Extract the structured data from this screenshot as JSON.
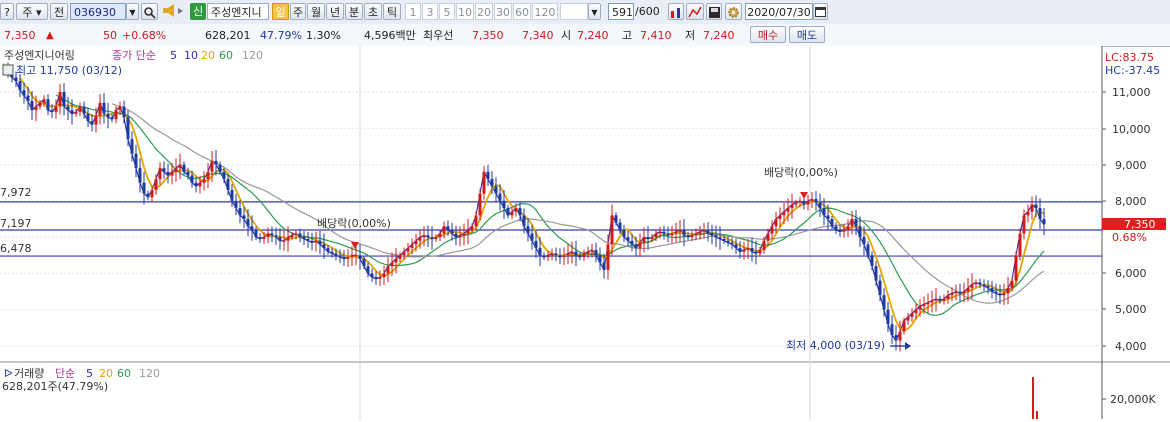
{
  "toolbar": {
    "menu_label": "주",
    "mode_label": "전",
    "code_value": "036930",
    "credit_label": "신",
    "stock_name": "주성엔지니",
    "period_selected": "일",
    "period_tabs": [
      "주",
      "월",
      "년",
      "분",
      "초",
      "틱"
    ],
    "interval_buttons": [
      "1",
      "3",
      "5",
      "10",
      "20",
      "30",
      "60",
      "120"
    ],
    "count_value": "591",
    "count_total": "/600",
    "date_value": "2020/07/30"
  },
  "quote": {
    "price": "7,350",
    "change_arrow": "▲",
    "change_value": "50",
    "change_pct": "+0.68%",
    "volume": "628,201",
    "turnover_pct": "47.79%",
    "ratio": "1.30%",
    "amount": "4,596백만",
    "best_bid_label": "최우선",
    "best_ask": "7,350",
    "best_bid": "7,340",
    "open_label": "시",
    "open": "7,240",
    "high_label": "고",
    "high": "7,410",
    "low_label": "저",
    "low": "7,240",
    "buy_label": "매수",
    "sell_label": "매도"
  },
  "colors": {
    "up": "#d21a1a",
    "down": "#1f3b9c",
    "ma5": "#2e2ea8",
    "ma20": "#e6a500",
    "ma60": "#2e9a52",
    "ma120": "#999999",
    "hline": "#3a3ab0",
    "price_tag": "#e01e1e"
  },
  "chart": {
    "legend": {
      "name": "주성엔지니어링",
      "price_label": "종가 단순",
      "ma": [
        "5",
        "10",
        "20",
        "60",
        "120"
      ]
    },
    "max_label": "최고 11,750 (03/12)",
    "min_label": "최저 4,000 (03/19)",
    "dividend_labels": [
      "배당락(0,00%)",
      "배당락(0,00%)"
    ],
    "hlines": [
      "7,972",
      "7,197",
      "6,478"
    ],
    "lc_label": "LC:83.75",
    "hc_label": "HC:-37.45",
    "price_tag": "7,350",
    "price_tag_pct": "0.68%",
    "y_ticks": [
      "11,000",
      "10,000",
      "9,000",
      "8,000",
      "6,000",
      "5,000",
      "4,000"
    ],
    "volume_legend": {
      "name": "거래량",
      "label": "단순",
      "ma": [
        "5",
        "20",
        "60",
        "120"
      ],
      "info": "628,201주(47.79%)"
    },
    "volume_tick": "20,000K"
  },
  "chart_data": {
    "type": "line",
    "x": [
      0,
      4,
      8,
      12,
      16,
      20,
      24,
      28,
      32,
      36,
      40,
      44,
      48,
      52,
      56,
      60,
      64,
      68,
      72,
      76,
      80,
      84,
      88,
      92,
      96,
      100,
      104,
      108,
      112,
      116,
      120,
      124,
      128,
      132,
      136,
      140,
      144,
      148,
      152,
      156,
      160,
      164,
      168,
      172,
      176,
      180,
      184,
      188,
      192,
      196,
      200,
      204,
      208,
      212,
      216,
      220,
      224,
      228,
      232,
      236,
      240,
      244,
      248,
      252,
      256,
      260,
      264,
      268,
      272,
      276,
      280,
      284,
      288,
      292,
      296,
      300,
      304,
      308,
      312,
      316,
      320,
      324,
      328,
      332,
      336,
      340,
      344,
      348,
      352,
      356,
      360,
      364,
      368,
      372,
      376,
      380,
      384,
      388,
      392,
      396,
      400,
      404,
      408,
      412,
      416,
      420,
      424,
      428,
      432,
      436,
      440,
      444,
      448,
      452,
      456,
      460,
      464,
      468,
      472,
      476,
      480,
      484,
      488,
      492,
      496,
      500,
      504,
      508,
      512,
      516,
      520,
      524,
      528,
      532,
      536,
      540,
      544,
      548,
      552,
      556,
      560,
      564,
      568,
      572,
      576,
      580,
      584,
      588,
      592,
      596,
      600,
      604,
      608,
      612,
      616,
      620,
      624,
      628,
      632,
      636,
      640,
      644,
      648,
      652,
      656,
      660,
      664,
      668,
      672,
      676,
      680,
      684,
      688,
      692,
      696,
      700,
      704,
      708,
      712,
      716,
      720,
      724,
      728,
      732,
      736,
      740,
      744,
      748,
      752,
      756,
      760,
      764,
      768,
      772,
      776,
      780,
      784,
      788,
      792,
      796,
      800,
      804,
      808,
      812,
      816,
      820,
      824,
      828,
      832,
      836,
      840,
      844,
      848,
      852,
      856,
      860,
      864,
      868,
      872,
      876,
      880,
      884,
      888,
      892,
      896,
      900,
      904,
      908,
      912,
      916,
      920,
      924,
      928,
      932,
      936,
      940,
      944,
      948,
      952,
      956,
      960,
      964,
      968,
      972,
      976,
      980,
      984,
      988,
      992,
      996,
      1000,
      1004,
      1008,
      1012,
      1016,
      1020,
      1024,
      1028,
      1032,
      1036,
      1040,
      1044,
      1048,
      1052,
      1056,
      1060,
      1064,
      1068
    ],
    "values": [
      11700,
      11500,
      11400,
      11300,
      11050,
      10900,
      10750,
      10500,
      10600,
      10700,
      10800,
      10500,
      10450,
      10600,
      11000,
      10600,
      10500,
      10400,
      10450,
      10600,
      10400,
      10200,
      10100,
      10350,
      10700,
      10400,
      10300,
      10250,
      10500,
      10600,
      10300,
      9700,
      9300,
      8900,
      8500,
      8200,
      8100,
      8300,
      8600,
      8900,
      8800,
      8700,
      8800,
      8900,
      9000,
      8800,
      8700,
      8500,
      8400,
      8500,
      8600,
      8800,
      9100,
      9000,
      8800,
      8600,
      8300,
      8000,
      7800,
      7600,
      7500,
      7300,
      7200,
      7000,
      6950,
      7000,
      7100,
      7050,
      7000,
      6900,
      6900,
      7000,
      7050,
      7100,
      7000,
      6950,
      6900,
      6850,
      6900,
      6800,
      6700,
      6600,
      6550,
      6500,
      6450,
      6400,
      6450,
      6500,
      6500,
      6400,
      6200,
      6000,
      5900,
      5850,
      5900,
      6000,
      6200,
      6300,
      6400,
      6500,
      6600,
      6700,
      6800,
      6900,
      7000,
      7050,
      7000,
      6950,
      7000,
      7100,
      7300,
      7200,
      7100,
      7000,
      7050,
      7100,
      7200,
      7300,
      7600,
      8200,
      8800,
      8600,
      8400,
      8200,
      8000,
      7800,
      7600,
      7700,
      7800,
      7600,
      7300,
      7100,
      6900,
      6700,
      6500,
      6450,
      6500,
      6550,
      6500,
      6450,
      6500,
      6550,
      6600,
      6500,
      6450,
      6550,
      6600,
      6650,
      6500,
      6300,
      6100,
      6800,
      7600,
      7400,
      7200,
      7000,
      6900,
      6800,
      6700,
      6850,
      7000,
      6950,
      7000,
      7100,
      7150,
      7100,
      7050,
      7100,
      7150,
      7200,
      7050,
      7000,
      7050,
      7100,
      7150,
      7200,
      7100,
      7050,
      7000,
      6950,
      6900,
      6850,
      6800,
      6700,
      6600,
      6650,
      6700,
      6600,
      6550,
      6650,
      6900,
      7100,
      7300,
      7500,
      7600,
      7700,
      7800,
      7900,
      7950,
      8000,
      7900,
      8000,
      8050,
      7950,
      7800,
      7600,
      7500,
      7300,
      7200,
      7150,
      7200,
      7300,
      7500,
      7300,
      7000,
      6800,
      6500,
      6200,
      5800,
      5400,
      5000,
      4600,
      4300,
      4150,
      4400,
      4700,
      4800,
      4900,
      5000,
      5100,
      5150,
      5200,
      5250,
      5300,
      5250,
      5300,
      5400,
      5450,
      5500,
      5450,
      5500,
      5600,
      5700,
      5750,
      5700,
      5650,
      5600,
      5500,
      5450,
      5400,
      5450,
      5600,
      5800,
      6500,
      7100,
      7600,
      7700,
      7900,
      7800,
      7500,
      7350
    ],
    "ylim": [
      3750,
      11900
    ],
    "hlines": [
      7972,
      7197,
      6478
    ],
    "max": {
      "value": 11750,
      "date": "03/12"
    },
    "min": {
      "value": 4000,
      "date": "03/19"
    },
    "last": 7350
  }
}
